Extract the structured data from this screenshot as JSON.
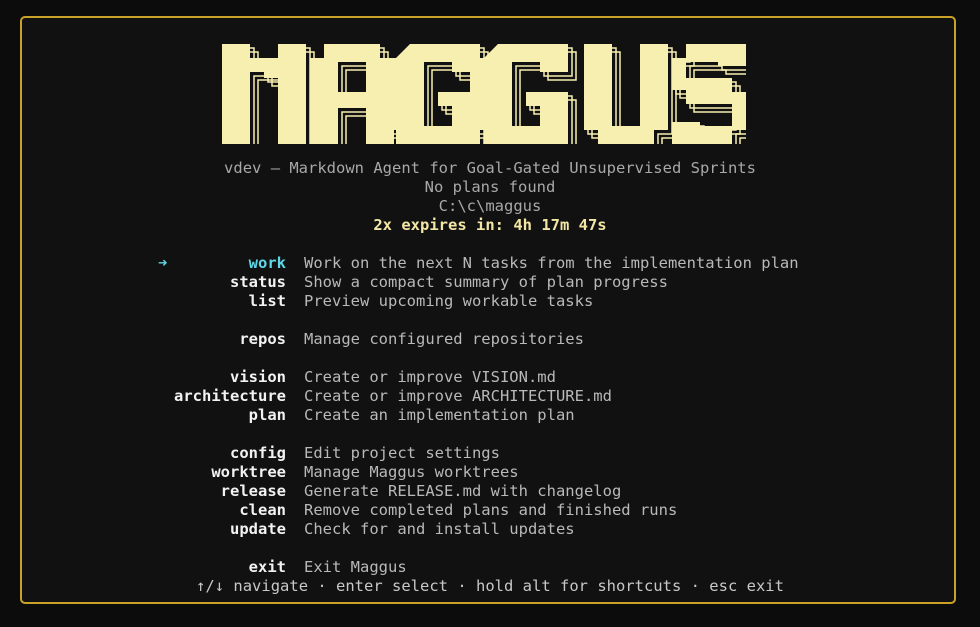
{
  "app": {
    "logo_text": "MAGGUS",
    "tagline": "vdev — Markdown Agent for Goal-Gated Unsupervised Sprints",
    "plans_status": "No plans found",
    "cwd": "C:\\c\\maggus",
    "timer": "2x expires in: 4h 17m 47s",
    "accent_color": "#5fd7e7",
    "logo_color": "#f7efb0",
    "border_color": "#c9a227"
  },
  "menu": {
    "selected_marker": "➜",
    "items": [
      {
        "cmd": "work",
        "desc": "Work on the next N tasks from the implementation plan"
      },
      {
        "cmd": "status",
        "desc": "Show a compact summary of plan progress"
      },
      {
        "cmd": "list",
        "desc": "Preview upcoming workable tasks"
      },
      {
        "cmd": "repos",
        "desc": "Manage configured repositories"
      },
      {
        "cmd": "vision",
        "desc": "Create or improve VISION.md"
      },
      {
        "cmd": "architecture",
        "desc": "Create or improve ARCHITECTURE.md"
      },
      {
        "cmd": "plan",
        "desc": "Create an implementation plan"
      },
      {
        "cmd": "config",
        "desc": "Edit project settings"
      },
      {
        "cmd": "worktree",
        "desc": "Manage Maggus worktrees"
      },
      {
        "cmd": "release",
        "desc": "Generate RELEASE.md with changelog"
      },
      {
        "cmd": "clean",
        "desc": "Remove completed plans and finished runs"
      },
      {
        "cmd": "update",
        "desc": "Check for and install updates"
      },
      {
        "cmd": "exit",
        "desc": "Exit Maggus"
      }
    ]
  },
  "footer": "↑/↓ navigate · enter select · hold alt for shortcuts · esc exit"
}
